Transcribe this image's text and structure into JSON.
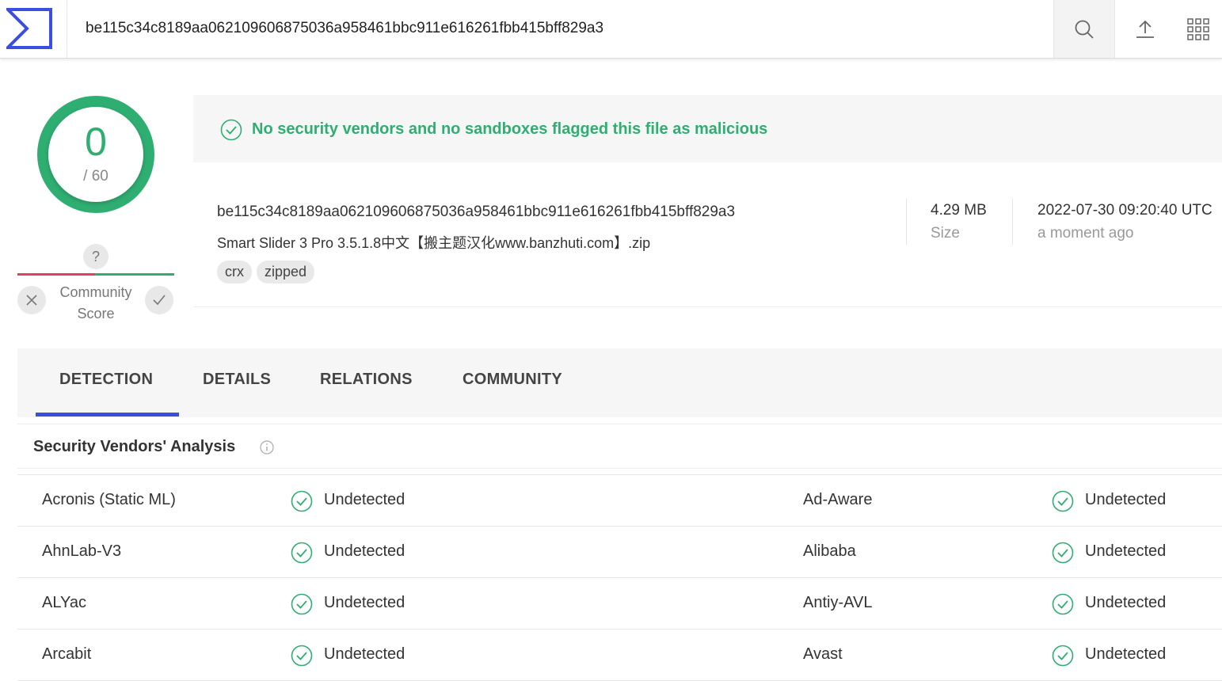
{
  "search": {
    "value": "be115c34c8189aa062109606875036a958461bbc911e616261fbb415bff829a3"
  },
  "icons": {
    "logo": "virustotal-logo-icon",
    "search": "search-icon",
    "upload": "upload-icon",
    "apps": "apps-grid-icon"
  },
  "score": {
    "detections": "0",
    "total": "/ 60"
  },
  "community": {
    "unknown": "?",
    "label": "Community Score"
  },
  "banner": {
    "text": "No security vendors and no sandboxes flagged this file as malicious"
  },
  "file": {
    "hash": "be115c34c8189aa062109606875036a958461bbc911e616261fbb415bff829a3",
    "name": "Smart Slider 3 Pro 3.5.1.8中文【搬主题汉化www.banzhuti.com】.zip",
    "tags": [
      "crx",
      "zipped"
    ],
    "size_value": "4.29 MB",
    "size_label": "Size",
    "date_value": "2022-07-30 09:20:40 UTC",
    "date_label": "a moment ago"
  },
  "tabs": [
    "DETECTION",
    "DETAILS",
    "RELATIONS",
    "COMMUNITY"
  ],
  "section": {
    "title": "Security Vendors' Analysis"
  },
  "vendors": [
    {
      "left": "Acronis (Static ML)",
      "left_result": "Undetected",
      "right": "Ad-Aware",
      "right_result": "Undetected"
    },
    {
      "left": "AhnLab-V3",
      "left_result": "Undetected",
      "right": "Alibaba",
      "right_result": "Undetected"
    },
    {
      "left": "ALYac",
      "left_result": "Undetected",
      "right": "Antiy-AVL",
      "right_result": "Undetected"
    },
    {
      "left": "Arcabit",
      "left_result": "Undetected",
      "right": "Avast",
      "right_result": "Undetected"
    }
  ],
  "colors": {
    "accent": "#3a4fe0",
    "clean": "#2fae72",
    "malicious": "#e3405f"
  }
}
